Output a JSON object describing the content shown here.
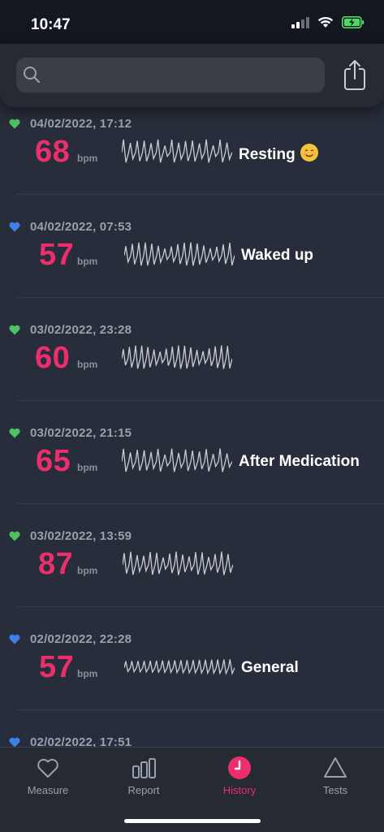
{
  "status_bar": {
    "time": "10:47"
  },
  "search": {
    "placeholder": "",
    "value": ""
  },
  "entries": [
    {
      "heart_color": "#4cc45e",
      "date": "04/02/2022, 17:12",
      "bpm": "68",
      "unit": "bpm",
      "note": "Resting",
      "emoji": "smiling-face-emoji"
    },
    {
      "heart_color": "#3f7fe8",
      "date": "04/02/2022, 07:53",
      "bpm": "57",
      "unit": "bpm",
      "note": "Waked up"
    },
    {
      "heart_color": "#4cc45e",
      "date": "03/02/2022, 23:28",
      "bpm": "60",
      "unit": "bpm",
      "note": ""
    },
    {
      "heart_color": "#4cc45e",
      "date": "03/02/2022, 21:15",
      "bpm": "65",
      "unit": "bpm",
      "note": "After Medication"
    },
    {
      "heart_color": "#4cc45e",
      "date": "03/02/2022, 13:59",
      "bpm": "87",
      "unit": "bpm",
      "note": ""
    },
    {
      "heart_color": "#3f7fe8",
      "date": "02/02/2022, 22:28",
      "bpm": "57",
      "unit": "bpm",
      "note": "General"
    },
    {
      "heart_color": "#3f7fe8",
      "date": "02/02/2022, 17:51",
      "bpm": "",
      "unit": "",
      "note": ""
    }
  ],
  "tabs": [
    {
      "label": "Measure",
      "icon": "heart-outline-icon",
      "active": false
    },
    {
      "label": "Report",
      "icon": "bar-chart-icon",
      "active": false
    },
    {
      "label": "History",
      "icon": "clock-icon",
      "active": true
    },
    {
      "label": "Tests",
      "icon": "triangle-icon",
      "active": false
    }
  ],
  "colors": {
    "accent": "#ed2e6c",
    "background": "#272d3a",
    "green_heart": "#4cc45e",
    "blue_heart": "#3f7fe8"
  }
}
